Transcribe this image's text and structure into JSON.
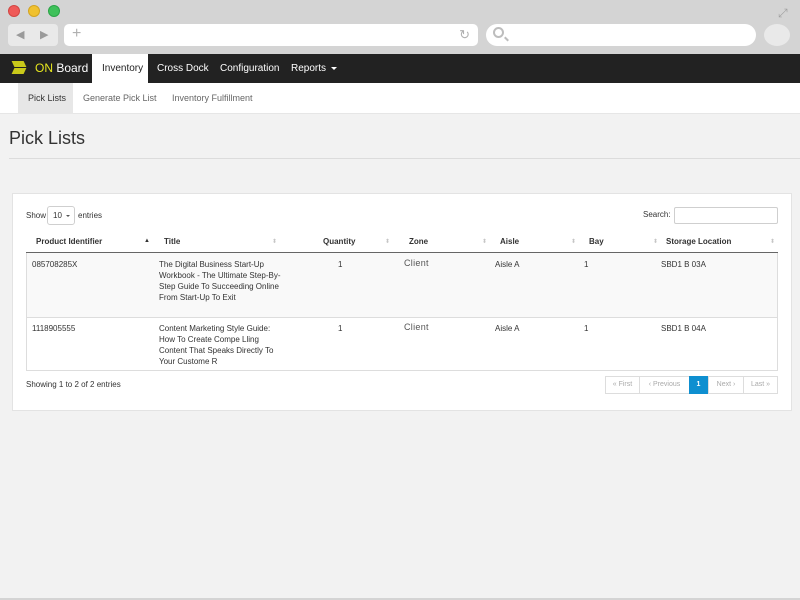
{
  "browser": {
    "back_icon": "◀",
    "forward_icon": "▶",
    "plus_icon": "+",
    "reload_icon": "↻",
    "expand_icon": "⤢"
  },
  "app": {
    "brand_on": "ON",
    "brand_rest": " Board",
    "nav": [
      {
        "label": "Inventory"
      },
      {
        "label": "Cross Dock"
      },
      {
        "label": "Configuration"
      },
      {
        "label": "Reports"
      }
    ]
  },
  "subnav": [
    "Pick Lists",
    "Generate Pick List",
    "Inventory Fulfillment"
  ],
  "page_title": "Pick Lists",
  "table_controls": {
    "show": "Show",
    "length": "10",
    "entries": "entries",
    "search": "Search:"
  },
  "columns": [
    "Product Identifier",
    "Title",
    "Quantity",
    "Zone",
    "Aisle",
    "Bay",
    "Storage Location"
  ],
  "rows": [
    {
      "product_identifier": "085708285X",
      "title": "The Digital Business Start-Up Workbook - The Ultimate Step-By-Step Guide To Succeeding Online From Start-Up To Exit",
      "quantity": "1",
      "zone": "Client",
      "aisle": "Aisle A",
      "bay": "1",
      "storage_location": "SBD1 B 03A"
    },
    {
      "product_identifier": "1118905555",
      "title": "Content Marketing Style Guide: How To Create Compe Lling Content That Speaks Directly To Your Custome R",
      "quantity": "1",
      "zone": "Client",
      "aisle": "Aisle A",
      "bay": "1",
      "storage_location": "SBD1 B 04A"
    }
  ],
  "info": "Showing 1 to 2 of 2 entries",
  "pagination": [
    "« First",
    "‹ Previous",
    "1",
    "Next ›",
    "Last »"
  ],
  "colors": {
    "accent": "#0e8fd0",
    "nav_bg": "#222222",
    "brand_yellow": "#e6e61e"
  }
}
